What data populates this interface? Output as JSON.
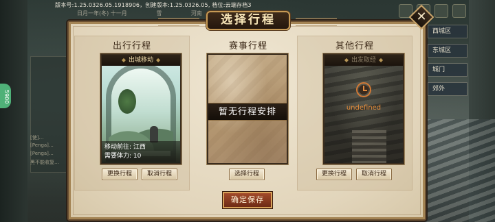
{
  "background": {
    "version_text": "版本号:1.25.0326.05.1918906，创建版本:1.25.0326.05, 档位:云端存档3",
    "date_text": "日月一年(冬) 十一月",
    "date_tag_1": "雪",
    "date_tag_2": "河南",
    "side_badge": "5900",
    "log_lines": [
      "[使]…",
      "[Penga]…",
      "[Penga]…",
      "黑不能收复…"
    ],
    "right_menu": [
      "西城区",
      "东城区",
      "城门",
      "郊外"
    ]
  },
  "modal": {
    "title": "选择行程",
    "close_symbol": "✕",
    "columns": [
      {
        "heading": "出行行程",
        "card_title": "出城移动",
        "destination_label": "移动前往:",
        "destination_value": "江西",
        "stamina_label": "需要体力:",
        "stamina_value": "10",
        "buttons": [
          "更换行程",
          "取消行程"
        ]
      },
      {
        "heading": "赛事行程",
        "empty_text": "暂无行程安排",
        "buttons": [
          "选择行程"
        ]
      },
      {
        "heading": "其他行程",
        "card_title": "出发取经",
        "status_text": "undefined",
        "buttons": [
          "更换行程",
          "取消行程"
        ]
      }
    ],
    "save_button": "确定保存"
  },
  "colors": {
    "modal_bg": "#e2d5bb",
    "frame_dark": "#3b2d1e",
    "gold_accent": "#c79a55",
    "save_red": "#8a3a20",
    "orange_status": "#e28c3c"
  }
}
